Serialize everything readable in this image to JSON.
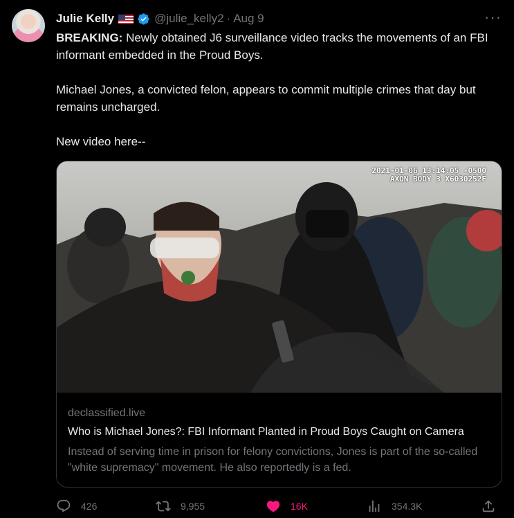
{
  "tweet": {
    "author_name": "Julie Kelly",
    "handle": "@julie_kelly2",
    "separator": "·",
    "date": "Aug 9",
    "more_label": "···",
    "flag_icon": "us-flag-icon",
    "verified_icon": "verified-badge-icon",
    "verified_color": "#1d9bf0",
    "text_lead": "BREAKING:",
    "text_p1_rest": " Newly obtained J6 surveillance video tracks the movements of an FBI informant embedded in the Proud Boys.",
    "text_p2": "Michael Jones, a convicted felon, appears to commit multiple crimes that day but remains uncharged.",
    "text_p3": "New video here--"
  },
  "card": {
    "image_stamp_line1": "2021-01-06 13:14:05 -0500",
    "image_stamp_line2": "AXON BODY 3 X6030252F",
    "domain": "declassified.live",
    "title": "Who is Michael Jones?: FBI Informant Planted in Proud Boys Caught on Camera",
    "description": "Instead of serving time in prison for felony convictions, Jones is part of the so-called \"white supremacy\" movement. He also reportedly is a fed."
  },
  "actions": {
    "reply_count": "426",
    "retweet_count": "9,955",
    "like_count": "16K",
    "views_count": "354.3K",
    "like_color": "#f91880"
  }
}
